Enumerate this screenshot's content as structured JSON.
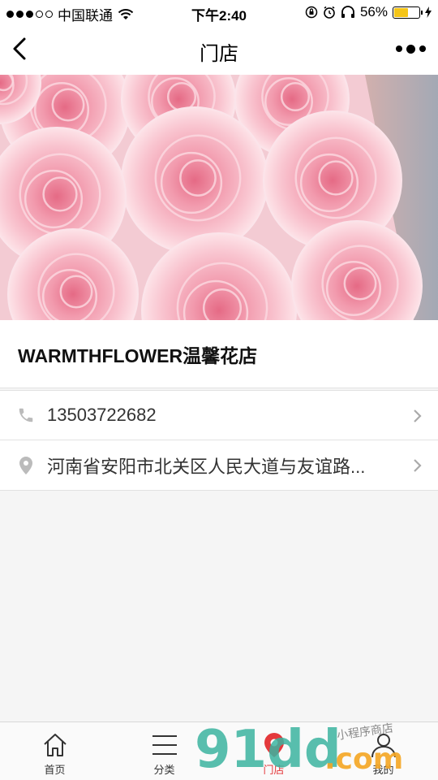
{
  "status_bar": {
    "carrier": "中国联通",
    "time": "下午2:40",
    "battery_percent": "56%",
    "battery_level": 0.56,
    "signal_bars_filled": 3,
    "signal_bars_total": 5
  },
  "navbar": {
    "title": "门店",
    "back_icon": "chevron-left-icon",
    "more_icon": "more-dots-icon"
  },
  "hero": {
    "image_subject": "pink-roses-photo"
  },
  "store": {
    "name": "WARMTHFLOWER温馨花店"
  },
  "info": {
    "phone": "13503722682",
    "address": "河南省安阳市北关区人民大道与友谊路..."
  },
  "tabbar": {
    "items": [
      {
        "label": "首页",
        "icon": "home-icon"
      },
      {
        "label": "分类",
        "icon": "menu-lines-icon"
      },
      {
        "label": "门店",
        "icon": "location-pin-icon",
        "active": true
      },
      {
        "label": "我的",
        "icon": "user-icon"
      }
    ]
  },
  "watermark": {
    "text_main": "91dd",
    "text_suffix": ".com",
    "text_small": "小程序商店"
  },
  "colors": {
    "accent": "#e4393c",
    "watermark_teal": "#3cb4a0",
    "watermark_green": "#8cc63f",
    "watermark_orange": "#f5a623",
    "battery_fill": "#f5c518"
  }
}
